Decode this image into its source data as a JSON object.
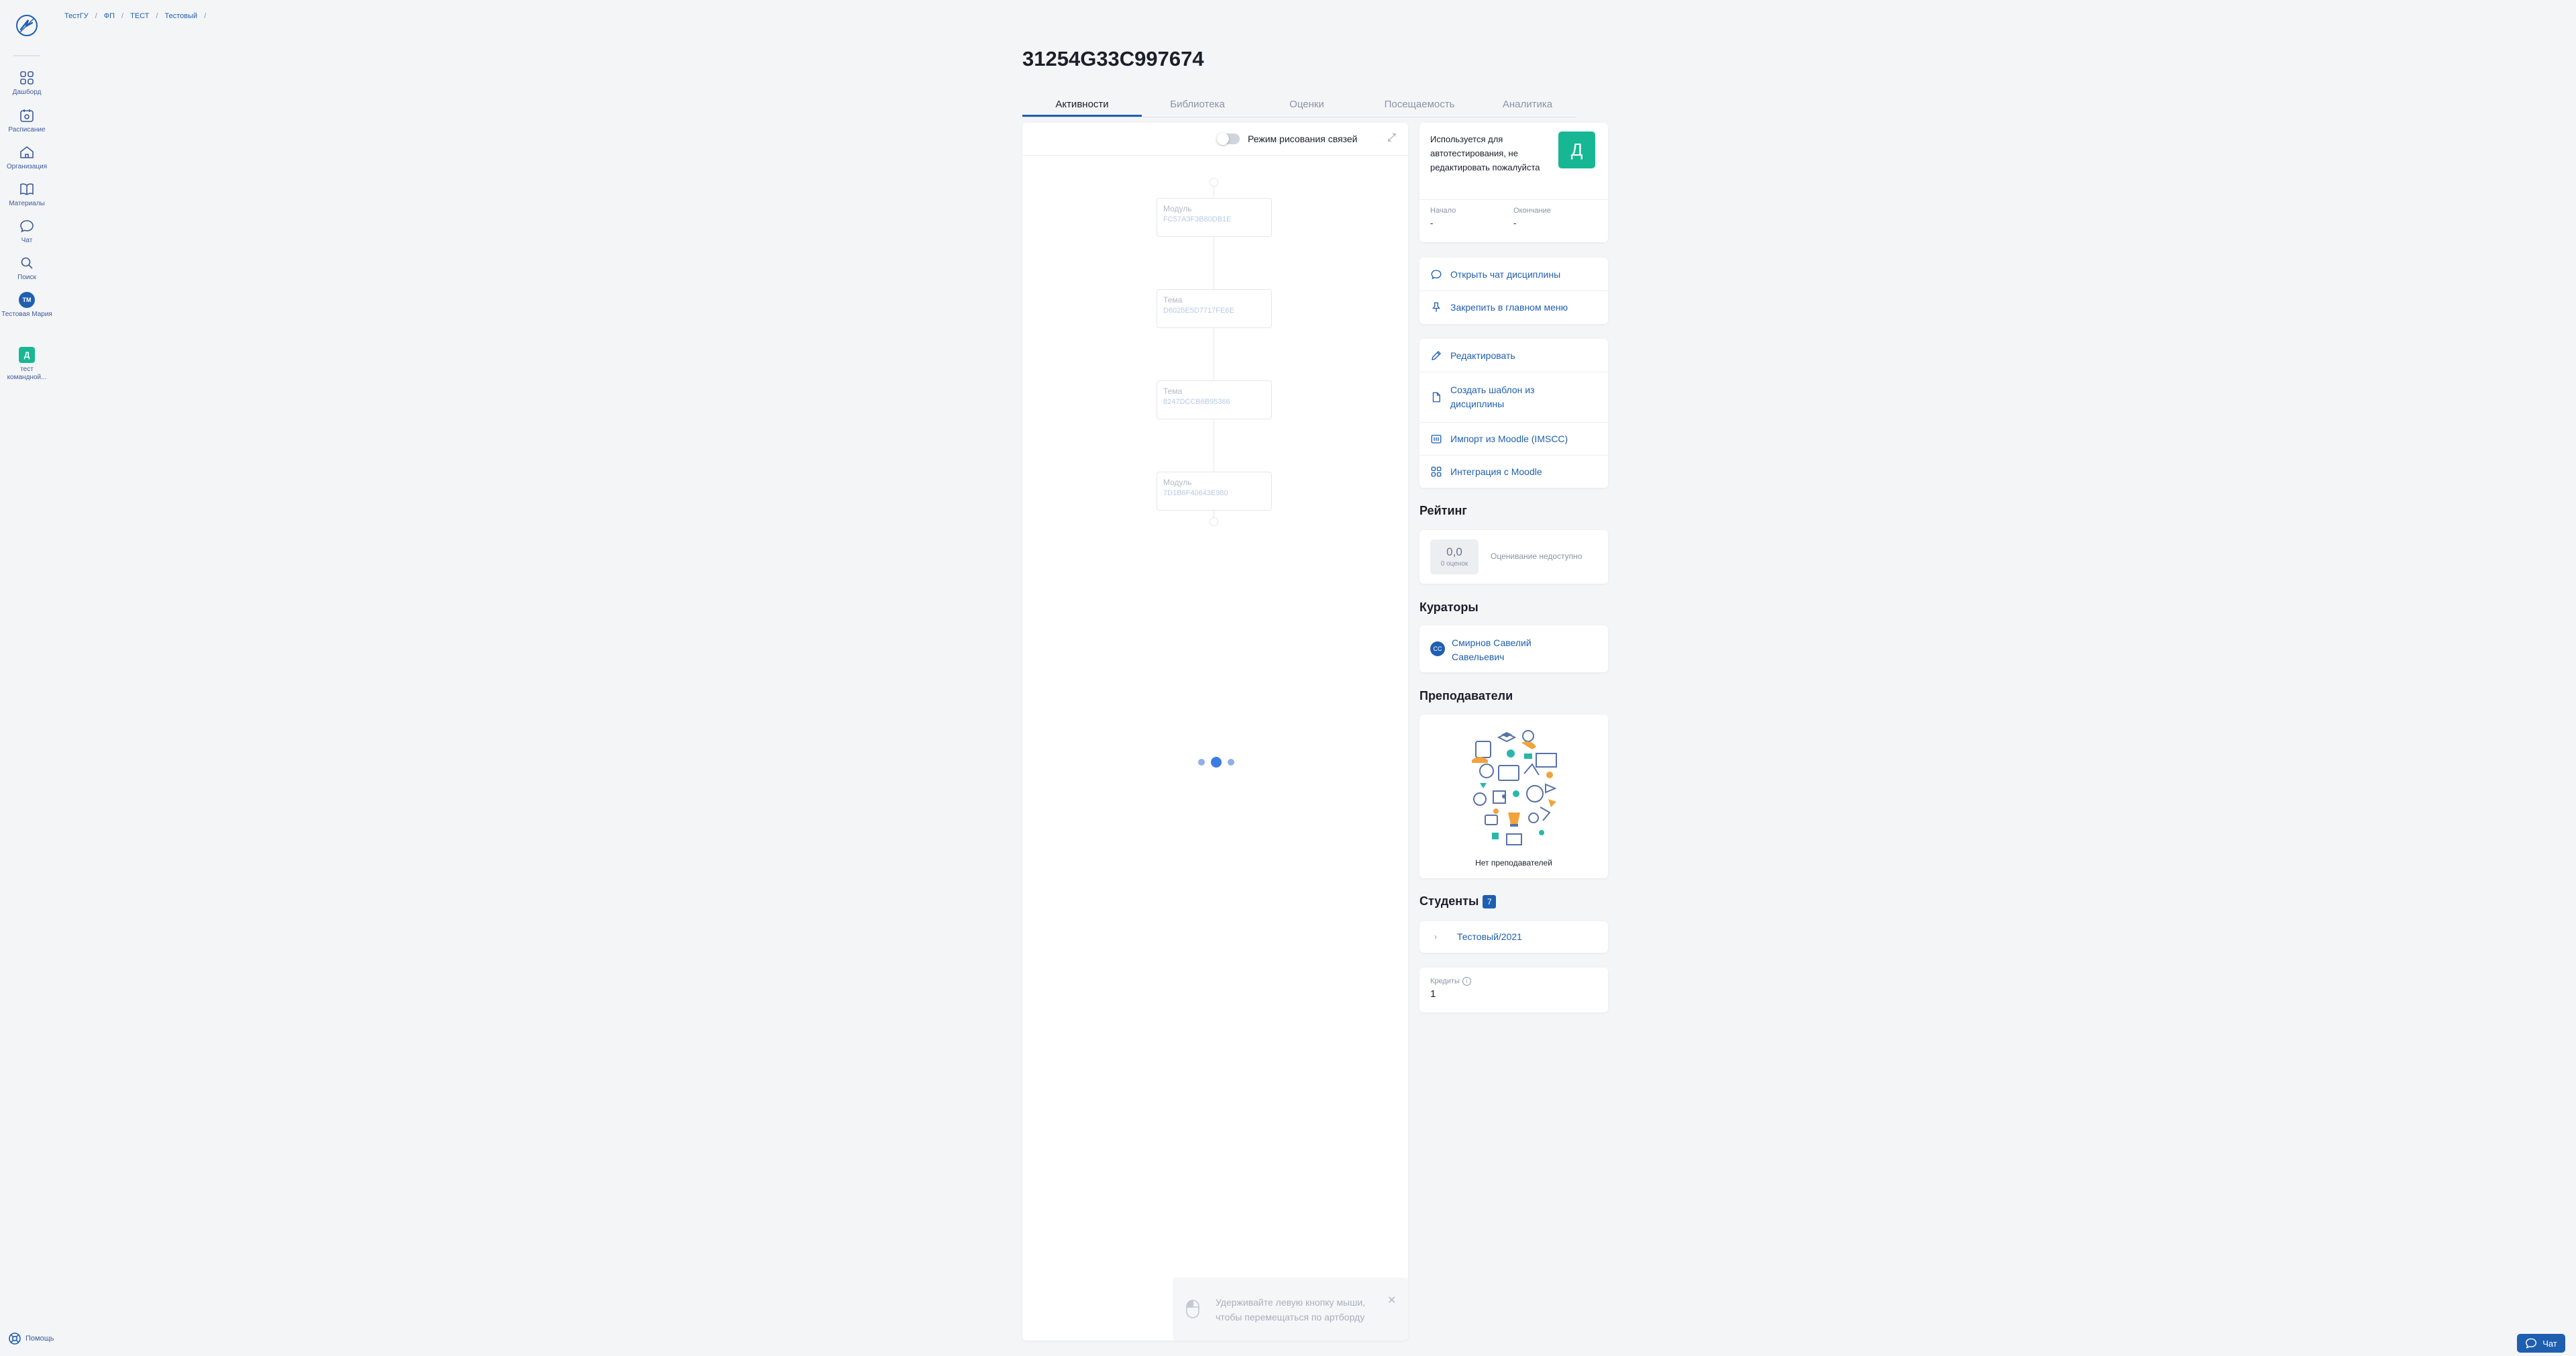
{
  "sidebar": {
    "items": [
      {
        "label": "Дашборд",
        "icon": "dashboard-icon"
      },
      {
        "label": "Расписание",
        "icon": "schedule-icon"
      },
      {
        "label": "Организация",
        "icon": "organization-icon"
      },
      {
        "label": "Материалы",
        "icon": "materials-icon"
      },
      {
        "label": "Чат",
        "icon": "chat-icon"
      },
      {
        "label": "Поиск",
        "icon": "search-icon"
      },
      {
        "label": "Тестовая Мария",
        "avatar": "ТМ"
      },
      {
        "label": "тест командной...",
        "avatar": "Д"
      }
    ],
    "help_label": "Помощь"
  },
  "breadcrumb": [
    "ТестГУ",
    "ФП",
    "ТЕСТ",
    "Тестовый"
  ],
  "page": {
    "title": "31254G33C997674"
  },
  "tabs": [
    "Активности",
    "Библиотека",
    "Оценки",
    "Посещаемость",
    "Аналитика"
  ],
  "board": {
    "toggle_label": "Режим рисования связей",
    "nodes": [
      {
        "type": "Модуль",
        "code": "FC57A3F3B80DB1E"
      },
      {
        "type": "Тема",
        "code": "D6025E5D7717FE6E"
      },
      {
        "type": "Тема",
        "code": "8247DCCB6B95366"
      },
      {
        "type": "Модуль",
        "code": "7D1B6F40643E980"
      }
    ],
    "hint": "Удерживайте левую кнопку мыши, чтобы перемещаться по артборду"
  },
  "info": {
    "description": "Используется для автотестирования, не редактировать пожалуйста",
    "avatar_letter": "Д",
    "start_label": "Начало",
    "start_value": "-",
    "end_label": "Окончание",
    "end_value": "-"
  },
  "actions1": [
    "Открыть чат дисциплины",
    "Закрепить в главном меню"
  ],
  "actions2": [
    "Редактировать",
    "Создать шаблон из дисциплины",
    "Импорт из Moodle (IMSCC)",
    "Интеграция с Moodle"
  ],
  "rating": {
    "title": "Рейтинг",
    "value": "0,0",
    "count": "0 оценок",
    "status": "Оценивание недоступно"
  },
  "curators": {
    "title": "Кураторы",
    "initials": "СС",
    "name": "Смирнов Савелий Савельевич"
  },
  "teachers": {
    "title": "Преподаватели",
    "empty": "Нет преподавателей"
  },
  "students": {
    "title": "Студенты",
    "count": "7",
    "group": "Тестовый/2021"
  },
  "credits": {
    "label": "Кредиты",
    "value": "1"
  },
  "chat_button": "Чат",
  "colors": {
    "accent": "#1f5fb0",
    "discipline": "#18b794",
    "background": "#f4f5f7"
  }
}
